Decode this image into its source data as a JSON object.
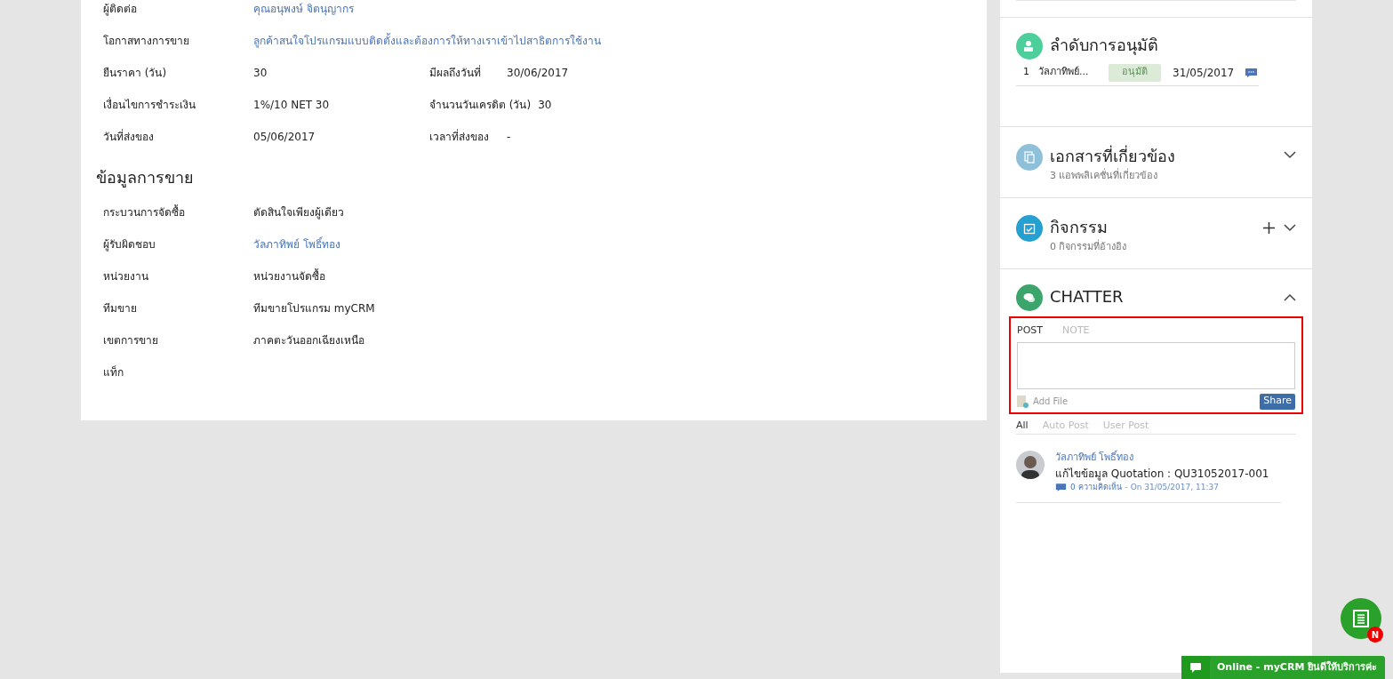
{
  "details": {
    "rows": [
      {
        "cells": [
          {
            "label": "ผู้ติดต่อ",
            "value": "คุณอนุพงษ์ จิตนุญากร",
            "link": true
          }
        ]
      },
      {
        "cells": [
          {
            "label": "โอกาสทางการขาย",
            "value": "ลูกค้าสนใจโปรแกรมแบบติดตั้งและต้องการให้ทางเราเข้าไปสาธิตการใช้งาน",
            "link": true
          }
        ]
      },
      {
        "cells": [
          {
            "label": "ยืนราคา (วัน)",
            "value": "30",
            "link": false
          },
          {
            "label": "มีผลถึงวันที่",
            "value": "30/06/2017",
            "link": false
          }
        ]
      },
      {
        "cells": [
          {
            "label": "เงื่อนไขการชำระเงิน",
            "value": "1%/10 NET 30",
            "link": false
          },
          {
            "label": "จำนวนวันเครดิต (วัน)",
            "value": "30",
            "link": false
          }
        ]
      },
      {
        "cells": [
          {
            "label": "วันที่ส่งของ",
            "value": "05/06/2017",
            "link": false
          },
          {
            "label": "เวลาที่ส่งของ",
            "value": "-",
            "link": false
          }
        ]
      }
    ]
  },
  "sales_info": {
    "heading": "ข้อมูลการขาย",
    "rows": [
      {
        "label": "กระบวนการจัดซื้อ",
        "value": "ตัดสินใจเพียงผู้เดียว",
        "link": false
      },
      {
        "label": "ผู้รับผิดชอบ",
        "value": "วัลภาทิพย์ โพธิ์ทอง",
        "link": true
      },
      {
        "label": "หน่วยงาน",
        "value": "หน่วยงานจัดซื้อ",
        "link": false
      },
      {
        "label": "ทีมขาย",
        "value": "ทีมขายโปรแกรม myCRM",
        "link": false
      },
      {
        "label": "เขตการขาย",
        "value": "ภาคตะวันออกเฉียงเหนือ",
        "link": false
      },
      {
        "label": "แท็ก"
      }
    ]
  },
  "approvals": {
    "title": "ลำดับการอนุมัติ",
    "rows": [
      {
        "index": "1",
        "name": "วัลภาทิพย์...",
        "status": "อนุมัติ",
        "date": "31/05/2017"
      }
    ]
  },
  "related_docs": {
    "title": "เอกสารที่เกี่ยวข้อง",
    "subtitle": "3 แอพพลิเคชั่นที่เกี่ยวข้อง",
    "expanded": false
  },
  "activities": {
    "title": "กิจกรรม",
    "subtitle": "0 กิจกรรมที่อ้างอิง",
    "expanded": false
  },
  "chatter": {
    "title": "CHATTER",
    "expanded": true,
    "composer_tabs": [
      {
        "label": "POST",
        "selected": true
      },
      {
        "label": "NOTE",
        "selected": false
      }
    ],
    "add_file": "Add File",
    "share": "Share",
    "filters": [
      {
        "label": "All",
        "selected": true
      },
      {
        "label": "Auto Post",
        "selected": false
      },
      {
        "label": "User Post",
        "selected": false
      }
    ],
    "posts": [
      {
        "author": "วัลภาทิพย์ โพธิ์ทอง",
        "text": "แก้ไขข้อมูล Quotation : QU31052017-001",
        "comments": "0 ความคิดเห็น",
        "time": "- On 31/05/2017, 11:37"
      }
    ]
  },
  "floating_badge": "N",
  "live_chat": "Online - myCRM ยินดีให้บริการค่ะ"
}
